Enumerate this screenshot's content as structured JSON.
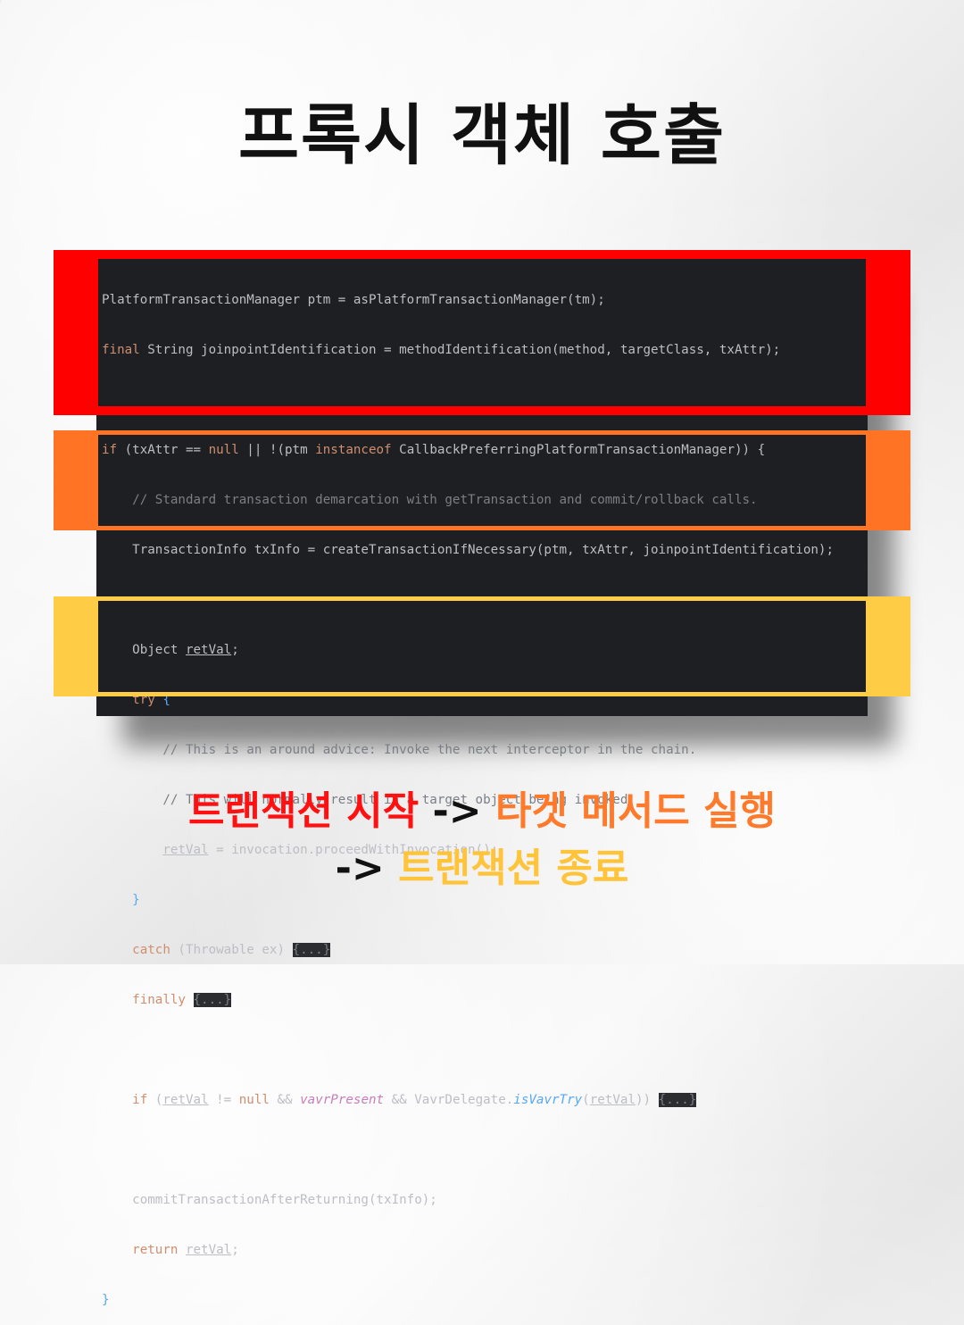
{
  "title": "프록시 객체 호출",
  "colors": {
    "red": "#ff0000",
    "orange": "#ff7325",
    "yellow": "#ffcc45",
    "code_bg": "#1e1f22"
  },
  "code": {
    "l1": "PlatformTransactionManager ptm = asPlatformTransactionManager(tm);",
    "l2_kw": "final",
    "l2_rest": " String joinpointIdentification = methodIdentification(method, targetClass, txAttr);",
    "l4_if": "if",
    "l4_a": " (txAttr == ",
    "l4_null": "null",
    "l4_b": " || !(ptm ",
    "l4_inst": "instanceof",
    "l4_c": " CallbackPreferringPlatformTransactionManager)) {",
    "l5": "    // Standard transaction demarcation with getTransaction and commit/rollback calls.",
    "l6": "    TransactionInfo txInfo = createTransactionIfNecessary(ptm, txAttr, joinpointIdentification);",
    "l8_a": "    Object ",
    "l8_var": "retVal",
    "l8_b": ";",
    "l9_try": "    try",
    "l9_b": " {",
    "l10": "        // This is an around advice: Invoke the next interceptor in the chain.",
    "l11": "        // This will normally result in a target object being invoked.",
    "l12_pre": "        ",
    "l12_var": "retVal",
    "l12_b": " = invocation.proceedWithInvocation();",
    "l13": "    }",
    "l14_catch": "    catch",
    "l14_b": " (Throwable ex) ",
    "l14_fold": "{...}",
    "l15_fin": "    finally",
    "l15_sp": " ",
    "l15_fold": "{...}",
    "l17_if": "    if",
    "l17_a": " (",
    "l17_var": "retVal",
    "l17_b": " != ",
    "l17_null": "null",
    "l17_c": " && ",
    "l17_vavr": "vavrPresent",
    "l17_d": " && VavrDelegate.",
    "l17_fn": "isVavrTry",
    "l17_e": "(",
    "l17_var2": "retVal",
    "l17_f": ")) ",
    "l17_fold": "{...}",
    "l19": "    commitTransactionAfterReturning(txInfo);",
    "l20_ret": "    return",
    "l20_sp": " ",
    "l20_var": "retVal",
    "l20_b": ";",
    "l21": "}"
  },
  "caption": {
    "part1": "트랜잭션 시작",
    "arrow1": " -> ",
    "part2": "타겟 메서드 실행",
    "arrow2": "-> ",
    "part3": "트랜잭션 종료"
  }
}
